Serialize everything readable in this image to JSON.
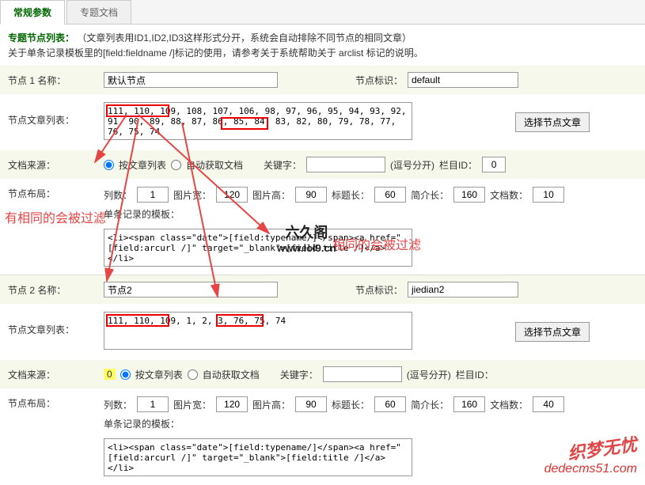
{
  "tabs": {
    "active": "常规参数",
    "inactive": "专题文档"
  },
  "header": {
    "title": "专题节点列表：",
    "desc": "（文章列表用ID1,ID2,ID3这样形式分开，系统会自动排除不同节点的相同文章）",
    "sub": "关于单条记录模板里的[field:fieldname /]标记的使用，请参考关于系统帮助关于 arclist 标记的说明。"
  },
  "labels": {
    "node_name": "节点 1 名称：",
    "node_name2": "节点 2 名称：",
    "node_flag": "节点标识：",
    "article_list": "节点文章列表：",
    "doc_source": "文档来源：",
    "by_list": "按文章列表",
    "auto_get": "自动获取文档",
    "keyword": "关键字：",
    "comma_sep": "(逗号分开)",
    "column_id": "栏目ID：",
    "layout": "节点布局：",
    "cols": "列数：",
    "imgw": "图片宽：",
    "imgh": "图片高：",
    "titlelen": "标题长：",
    "infolen": "简介长：",
    "docnum": "文档数：",
    "tpl": "单条记录的模板：",
    "select_btn": "选择节点文章"
  },
  "node1": {
    "name": "默认节点",
    "flag": "default",
    "ids": "111, 110, 109, 108, 107, 106, 98, 97, 96, 95, 94, 93, 92, 91, 90, 89, 88, 87, 86, 85, 84, 83, 82, 80, 79, 78, 77, 76, 75, 74",
    "keyword": "",
    "colid": "0",
    "cols": "1",
    "imgw": "120",
    "imgh": "90",
    "titlelen": "60",
    "infolen": "160",
    "docnum": "10",
    "tpl": "<li><span class=\"date\">[field:typename/]</span><a href=\"[field:arcurl /]\" target=\"_blank\">[field:title /]</a></li>"
  },
  "node2": {
    "name": "节点2",
    "flag": "jiedian2",
    "ids": "111, 110, 109, 1, 2, 3, 76, 75, 74",
    "colid_hl": "0",
    "keyword": "",
    "cols": "1",
    "imgw": "120",
    "imgh": "90",
    "titlelen": "60",
    "infolen": "160",
    "docnum": "40",
    "tpl": "<li><span class=\"date\">[field:typename/]</span><a href=\"[field:arcurl /]\" target=\"_blank\">[field:title /]</a></li>"
  },
  "annotations": {
    "left": "有相同的会被过滤",
    "right": "相同的会被过滤"
  },
  "watermark": {
    "main": "织梦无忧",
    "url": "dedecms51.com",
    "center": "六久阁",
    "center_url": "www.lol9.cn"
  }
}
